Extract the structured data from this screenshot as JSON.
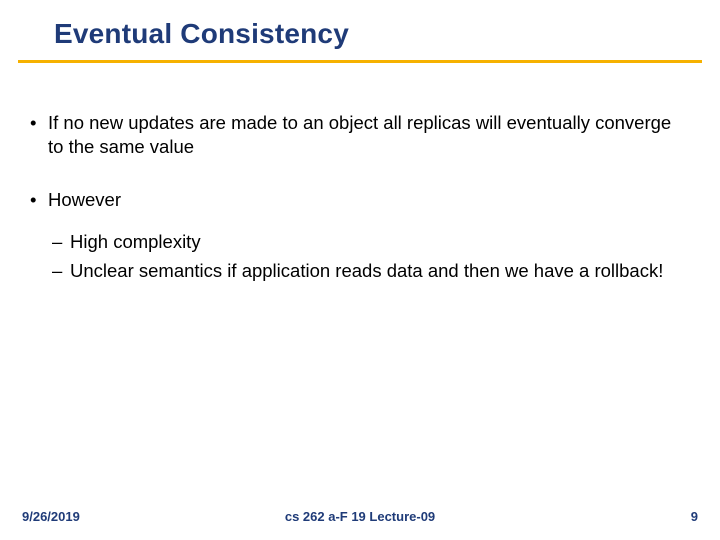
{
  "title": "Eventual Consistency",
  "bullets": {
    "b1": "If no new updates are made to an object all replicas will eventually converge to the same value",
    "b2": "However",
    "b2_sub1": "High complexity",
    "b2_sub2": "Unclear semantics if application reads data and then we have a rollback!"
  },
  "footer": {
    "date": "9/26/2019",
    "center": "cs 262 a-F 19 Lecture-09",
    "page": "9"
  },
  "colors": {
    "accent_blue": "#1f3b78",
    "accent_gold": "#f6b100"
  }
}
